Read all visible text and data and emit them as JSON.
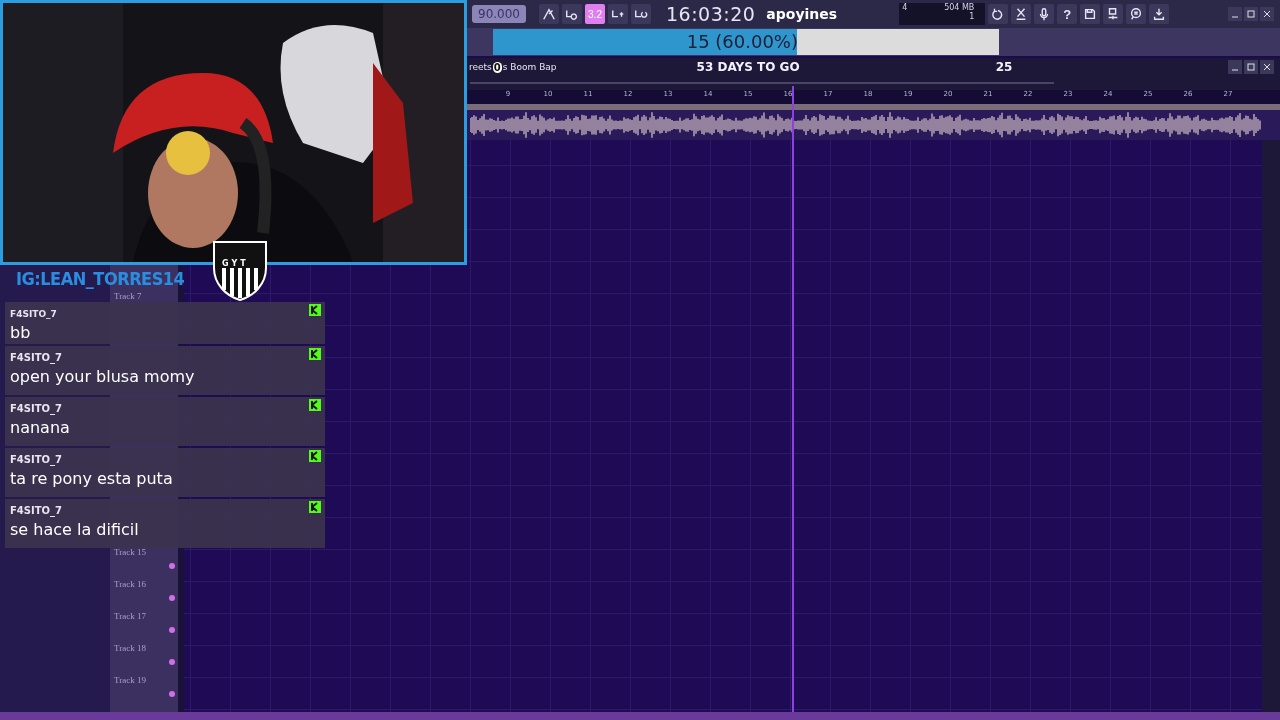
{
  "overlay": {
    "handle": "IG:LEAN_TORRES14",
    "crest_text": "GYT"
  },
  "toolbar": {
    "tempo": "90.000",
    "pattern": "3.2",
    "time": "16:03:20",
    "hint": "apoyines",
    "cpu": "4",
    "memory": "504 MB",
    "polyphony": "1",
    "help": "?"
  },
  "progress": {
    "label": "15 (60.00%)",
    "level": 0.6
  },
  "playlist": {
    "breadcrumb_start": "reets",
    "breadcrumb_badge": "0",
    "breadcrumb_end": "s Boom Bap",
    "countdown": "53 DAYS TO GO",
    "count": "25",
    "ruler": [
      "9",
      "10",
      "11",
      "12",
      "13",
      "14",
      "15",
      "16",
      "17",
      "18",
      "19",
      "20",
      "21",
      "22",
      "23",
      "24",
      "25",
      "26",
      "27"
    ],
    "tracks": [
      {
        "label": "Track 7"
      },
      {
        "label": "Track 15"
      },
      {
        "label": "Track 16"
      },
      {
        "label": "Track 17"
      },
      {
        "label": "Track 18"
      },
      {
        "label": "Track 19"
      }
    ]
  },
  "chat": [
    {
      "user": "F4SITO_7",
      "message": "bb"
    },
    {
      "user": "F4SITO_7",
      "message": "open your blusa momy"
    },
    {
      "user": "F4SITO_7",
      "message": "nanana"
    },
    {
      "user": "F4SITO_7",
      "message": "ta re pony esta puta"
    },
    {
      "user": "F4SITO_7",
      "message": "se hace la dificil"
    }
  ]
}
